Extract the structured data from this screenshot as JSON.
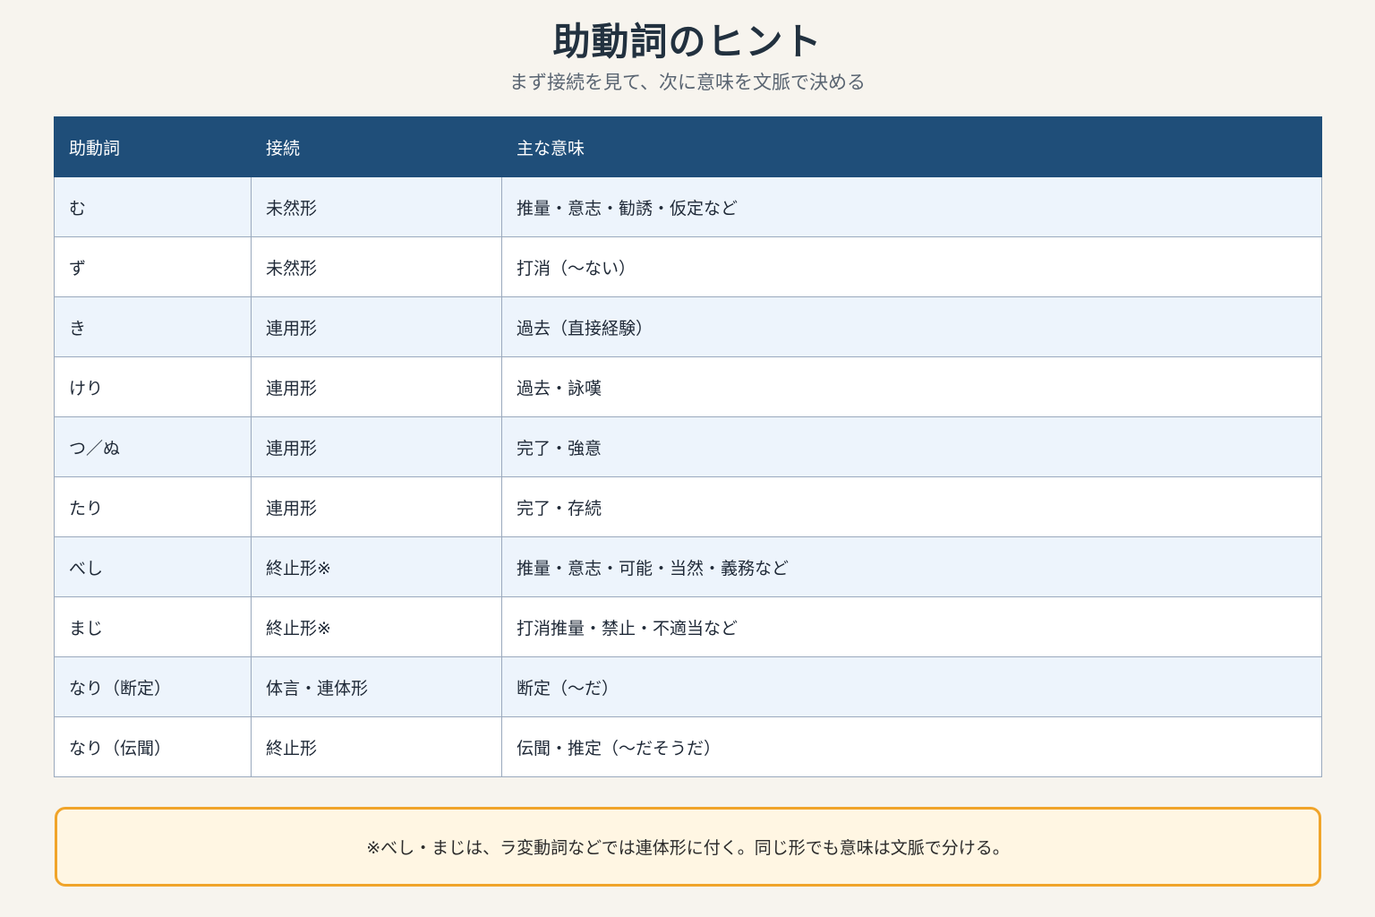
{
  "header": {
    "title": "助動詞のヒント",
    "subtitle": "まず接続を見て、次に意味を文脈で決める"
  },
  "table": {
    "columns": [
      "助動詞",
      "接続",
      "主な意味"
    ],
    "rows": [
      [
        "む",
        "未然形",
        "推量・意志・勧誘・仮定など"
      ],
      [
        "ず",
        "未然形",
        "打消（〜ない）"
      ],
      [
        "き",
        "連用形",
        "過去（直接経験）"
      ],
      [
        "けり",
        "連用形",
        "過去・詠嘆"
      ],
      [
        "つ／ぬ",
        "連用形",
        "完了・強意"
      ],
      [
        "たり",
        "連用形",
        "完了・存続"
      ],
      [
        "べし",
        "終止形※",
        "推量・意志・可能・当然・義務など"
      ],
      [
        "まじ",
        "終止形※",
        "打消推量・禁止・不適当など"
      ],
      [
        "なり（断定）",
        "体言・連体形",
        "断定（〜だ）"
      ],
      [
        "なり（伝聞）",
        "終止形",
        "伝聞・推定（〜だそうだ）"
      ]
    ]
  },
  "note": {
    "text": "※べし・まじは、ラ変動詞などでは連体形に付く。同じ形でも意味は文脈で分ける。"
  }
}
